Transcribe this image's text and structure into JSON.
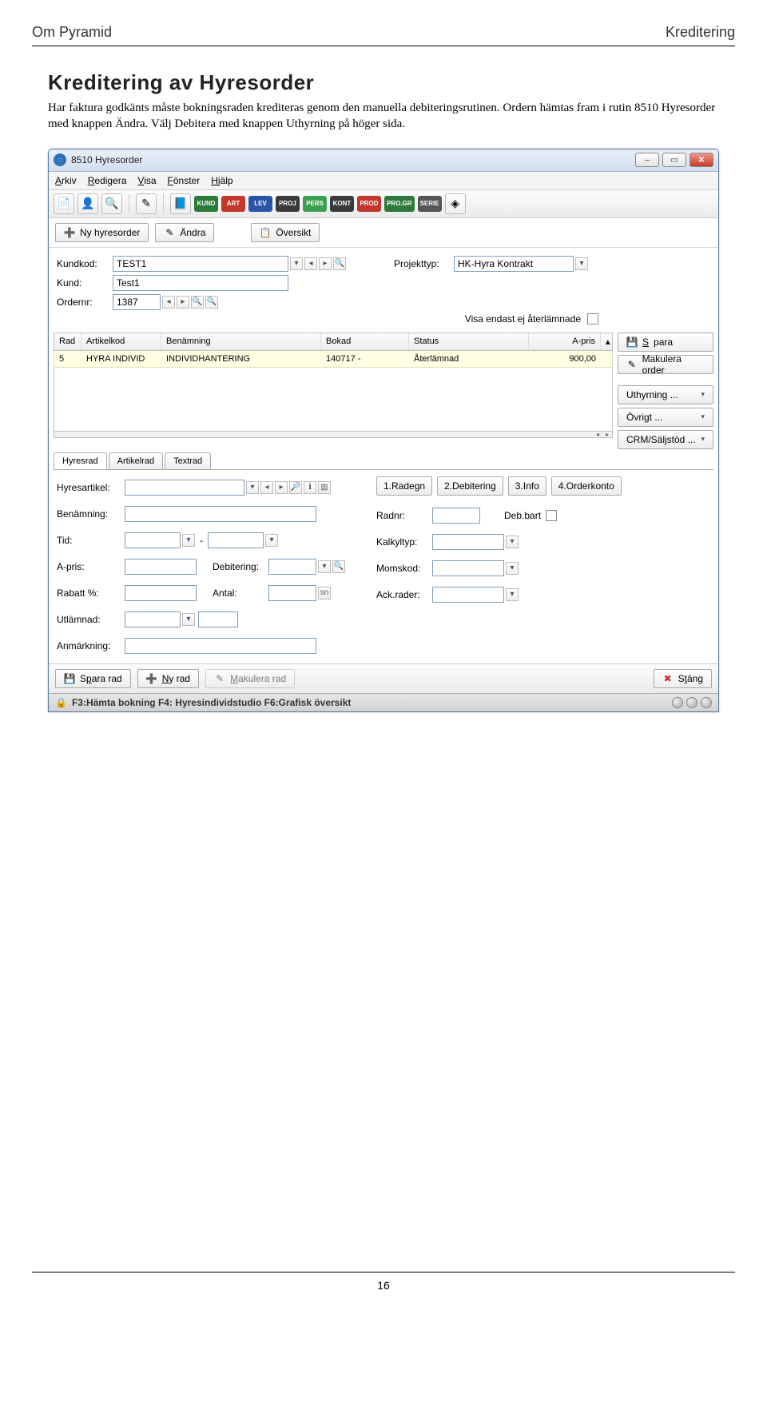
{
  "doc": {
    "header_left": "Om Pyramid",
    "header_right": "Kreditering",
    "title": "Kreditering av Hyresorder",
    "para": "Har faktura godkänts måste bokningsraden krediteras genom den manuella debiteringsrutinen. Ordern hämtas fram i rutin 8510 Hyresorder med knappen Ändra. Välj Debitera med knappen Uthyrning på höger sida.",
    "page_num": "16"
  },
  "win": {
    "title": "8510 Hyresorder",
    "menus": [
      "Arkiv",
      "Redigera",
      "Visa",
      "Fönster",
      "Hjälp"
    ],
    "pills": [
      "KUND",
      "ART",
      "LEV",
      "PROJ",
      "PERS",
      "KONT",
      "PROD",
      "PRO.GR",
      "SERIE"
    ],
    "topbtns": {
      "ny": "Ny hyresorder",
      "andra": "Ändra",
      "oversikt": "Översikt"
    },
    "fields": {
      "kundkod_lbl": "Kundkod:",
      "kundkod": "TEST1",
      "kund_lbl": "Kund:",
      "kund": "Test1",
      "ordernr_lbl": "Ordernr:",
      "ordernr": "1387",
      "projekttyp_lbl": "Projekttyp:",
      "projekttyp": "HK-Hyra Kontrakt",
      "visa_cb": "Visa endast ej återlämnade"
    },
    "grid": {
      "hdr": [
        "Rad",
        "Artikelkod",
        "Benämning",
        "Bokad",
        "Status",
        "A-pris"
      ],
      "row": [
        "5",
        "HYRA INDIVID",
        "INDIVIDHANTERING",
        "140717 -",
        "Återlämnad",
        "900,00"
      ]
    },
    "sidebtns": {
      "spara": "Spara",
      "makulera": "Makulera order",
      "uthyrning": "Uthyrning ...",
      "ovrigt": "Övrigt ...",
      "crm": "CRM/Säljstöd ..."
    },
    "lowtabs": [
      "Hyresrad",
      "Artikelrad",
      "Textrad"
    ],
    "lower_left": {
      "hyresartikel": "Hyresartikel:",
      "benamning": "Benämning:",
      "tid": "Tid:",
      "apris": "A-pris:",
      "debitering": "Debitering:",
      "rabatt": "Rabatt %:",
      "antal": "Antal:",
      "utlamnad": "Utlämnad:",
      "anmarkning": "Anmärkning:"
    },
    "rbtns": [
      "1.Radegn",
      "2.Debitering",
      "3.Info",
      "4.Orderkonto"
    ],
    "lower_right": {
      "radnr": "Radnr:",
      "debbart": "Deb.bart",
      "kalkyltyp": "Kalkyltyp:",
      "momskod": "Momskod:",
      "ackrader": "Ack.rader:"
    },
    "bottom": {
      "spara_rad": "Spara rad",
      "ny_rad": "Ny rad",
      "makulera_rad": "Makulera rad",
      "stang": "Stäng"
    },
    "status": "F3:Hämta bokning F4: Hyresindividstudio F6:Grafisk översikt"
  }
}
